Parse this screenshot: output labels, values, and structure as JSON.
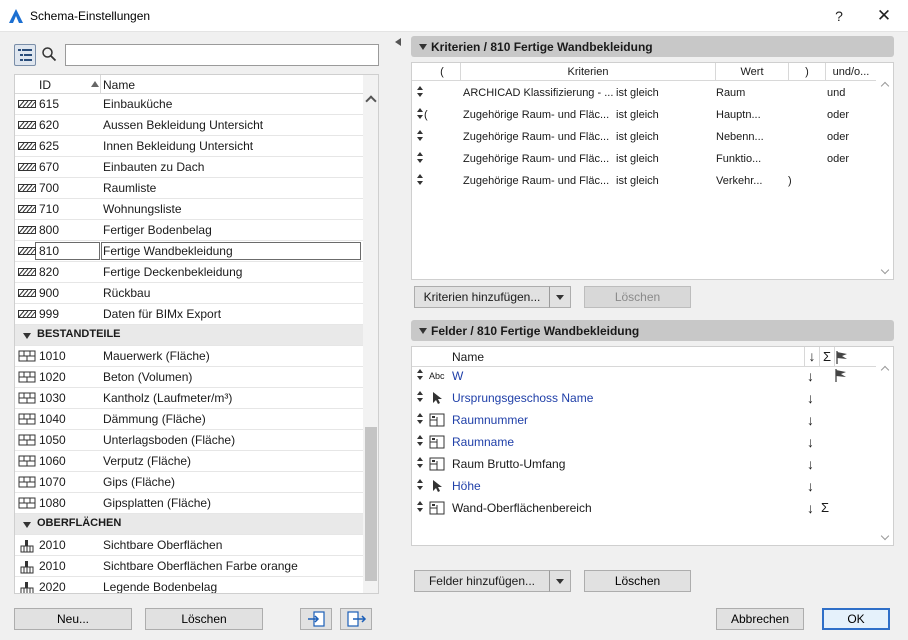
{
  "window": {
    "title": "Schema-Einstellungen",
    "help_label": "?",
    "close_label": "✕"
  },
  "search": {
    "value": "",
    "placeholder": ""
  },
  "list": {
    "headers": {
      "id": "ID",
      "name": "Name"
    },
    "rows": [
      {
        "type": "item",
        "icon": "hatch-icon",
        "id": "615",
        "name": "Einbauküche"
      },
      {
        "type": "item",
        "icon": "hatch-icon",
        "id": "620",
        "name": "Aussen Bekleidung Untersicht"
      },
      {
        "type": "item",
        "icon": "hatch-icon",
        "id": "625",
        "name": "Innen Bekleidung Untersicht"
      },
      {
        "type": "item",
        "icon": "hatch-icon",
        "id": "670",
        "name": "Einbauten zu Dach"
      },
      {
        "type": "item",
        "icon": "hatch-icon",
        "id": "700",
        "name": "Raumliste"
      },
      {
        "type": "item",
        "icon": "hatch-icon",
        "id": "710",
        "name": "Wohnungsliste"
      },
      {
        "type": "item",
        "icon": "hatch-icon",
        "id": "800",
        "name": "Fertiger Bodenbelag"
      },
      {
        "type": "item",
        "icon": "hatch-icon",
        "id": "810",
        "name": "Fertige Wandbekleidung",
        "selected": true
      },
      {
        "type": "item",
        "icon": "hatch-icon",
        "id": "820",
        "name": "Fertige Deckenbekleidung"
      },
      {
        "type": "item",
        "icon": "hatch-icon",
        "id": "900",
        "name": "Rückbau"
      },
      {
        "type": "item",
        "icon": "hatch-icon",
        "id": "999",
        "name": "Daten für BIMx Export"
      },
      {
        "type": "group",
        "name": "BESTANDTEILE"
      },
      {
        "type": "item",
        "icon": "brick-icon",
        "id": "1010",
        "name": "Mauerwerk (Fläche)"
      },
      {
        "type": "item",
        "icon": "brick-icon",
        "id": "1020",
        "name": "Beton (Volumen)"
      },
      {
        "type": "item",
        "icon": "brick-icon",
        "id": "1030",
        "name": "Kantholz (Laufmeter/m³)"
      },
      {
        "type": "item",
        "icon": "brick-icon",
        "id": "1040",
        "name": "Dämmung (Fläche)"
      },
      {
        "type": "item",
        "icon": "brick-icon",
        "id": "1050",
        "name": "Unterlagsboden (Fläche)"
      },
      {
        "type": "item",
        "icon": "brick-icon",
        "id": "1060",
        "name": "Verputz (Fläche)"
      },
      {
        "type": "item",
        "icon": "brick-icon",
        "id": "1070",
        "name": "Gips (Fläche)"
      },
      {
        "type": "item",
        "icon": "brick-icon",
        "id": "1080",
        "name": "Gipsplatten (Fläche)"
      },
      {
        "type": "group",
        "name": "OBERFLÄCHEN"
      },
      {
        "type": "item",
        "icon": "paintbrush-icon",
        "id": "2010",
        "name": "Sichtbare Oberflächen"
      },
      {
        "type": "item",
        "icon": "paintbrush-icon",
        "id": "2010",
        "name": "Sichtbare Oberflächen Farbe orange"
      },
      {
        "type": "item",
        "icon": "paintbrush-icon",
        "id": "2020",
        "name": "Legende Bodenbelag"
      }
    ]
  },
  "left_buttons": {
    "new_label": "Neu...",
    "delete_label": "Löschen"
  },
  "criteria": {
    "section_title": "Kriterien / 810 Fertige Wandbekleidung",
    "headers": {
      "open": "(",
      "criteria": "Kriterien",
      "value": "Wert",
      "close": ")",
      "andor": "und/o..."
    },
    "rows": [
      {
        "open": "",
        "criterion": "ARCHICAD Klassifizierung - ...",
        "op": "ist gleich",
        "value": "Raum",
        "close": "",
        "andor": "und"
      },
      {
        "open": "(",
        "criterion": "Zugehörige Raum- und Fläc...",
        "op": "ist gleich",
        "value": "Hauptn...",
        "close": "",
        "andor": "oder"
      },
      {
        "open": "",
        "criterion": "Zugehörige Raum- und Fläc...",
        "op": "ist gleich",
        "value": "Nebenn...",
        "close": "",
        "andor": "oder"
      },
      {
        "open": "",
        "criterion": "Zugehörige Raum- und Fläc...",
        "op": "ist gleich",
        "value": "Funktio...",
        "close": "",
        "andor": "oder"
      },
      {
        "open": "",
        "criterion": "Zugehörige Raum- und Fläc...",
        "op": "ist gleich",
        "value": "Verkehr...",
        "close": ")",
        "andor": ""
      }
    ],
    "add_label": "Kriterien hinzufügen...",
    "delete_label": "Löschen"
  },
  "fields": {
    "section_title": "Felder / 810 Fertige Wandbekleidung",
    "headers": {
      "name": "Name",
      "sort": "↓",
      "sum": "Σ"
    },
    "rows": [
      {
        "icon": "abc-icon",
        "icon_text": "Abc",
        "name": "W",
        "blue": true,
        "sort": "↓",
        "sum": "",
        "flag": true
      },
      {
        "icon": "cursor-icon",
        "name": "Ursprungsgeschoss Name",
        "blue": true,
        "sort": "↓",
        "sum": "",
        "flag": false
      },
      {
        "icon": "room-icon",
        "name": "Raumnummer",
        "blue": true,
        "sort": "↓",
        "sum": "",
        "flag": false
      },
      {
        "icon": "room-icon",
        "name": "Raumname",
        "blue": true,
        "sort": "↓",
        "sum": "",
        "flag": false
      },
      {
        "icon": "room-icon",
        "name": "Raum Brutto-Umfang",
        "blue": false,
        "sort": "↓",
        "sum": "",
        "flag": false
      },
      {
        "icon": "cursor-icon",
        "name": "Höhe",
        "blue": true,
        "sort": "↓",
        "sum": "",
        "flag": false
      },
      {
        "icon": "room-icon",
        "name": "Wand-Oberflächenbereich",
        "blue": false,
        "sort": "↓",
        "sum": "Σ",
        "flag": false
      }
    ],
    "add_label": "Felder hinzufügen...",
    "delete_label": "Löschen"
  },
  "footer": {
    "cancel_label": "Abbrechen",
    "ok_label": "OK"
  },
  "colors": {
    "accent": "#2f6fc8",
    "link_blue": "#1f3fa8",
    "section_header": "#c8c8c8",
    "group_row": "#e9e9e9"
  }
}
